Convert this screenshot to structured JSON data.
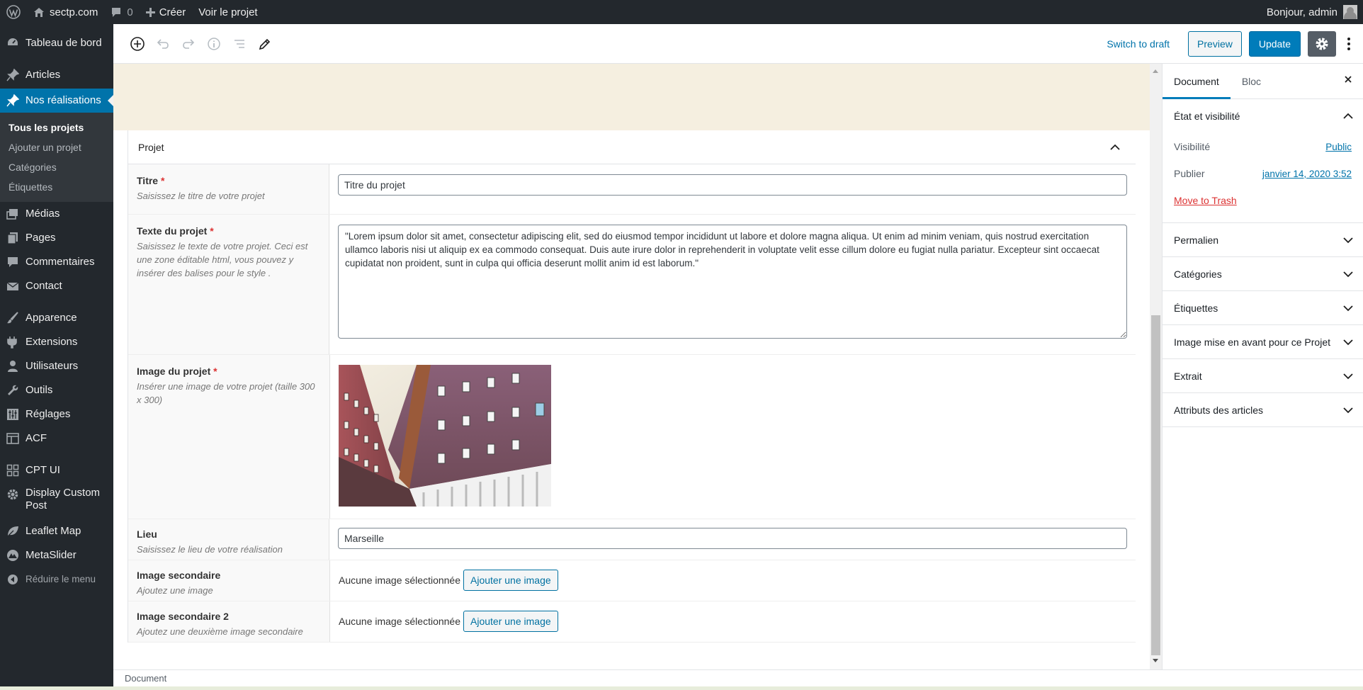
{
  "adminbar": {
    "site_name": "sectp.com",
    "comments_count": "0",
    "create_label": "Créer",
    "view_label": "Voir le projet",
    "greeting": "Bonjour, admin"
  },
  "menu": {
    "dashboard": "Tableau de bord",
    "articles": "Articles",
    "realisations": "Nos réalisations",
    "sub": [
      "Tous les projets",
      "Ajouter un projet",
      "Catégories",
      "Étiquettes"
    ],
    "media": "Médias",
    "pages": "Pages",
    "comments": "Commentaires",
    "contact": "Contact",
    "appearance": "Apparence",
    "extensions": "Extensions",
    "users": "Utilisateurs",
    "tools": "Outils",
    "settings": "Réglages",
    "acf": "ACF",
    "cptui": "CPT UI",
    "display_custom_post": "Display Custom Post",
    "leaflet": "Leaflet Map",
    "metaslider": "MetaSlider",
    "collapse": "Réduire le menu"
  },
  "toolbar": {
    "switch_draft": "Switch to draft",
    "preview": "Preview",
    "update": "Update"
  },
  "metabox": {
    "title": "Projet",
    "fields": {
      "titre": {
        "label": "Titre",
        "required": "*",
        "desc": "Saisissez le titre de votre projet",
        "value": "Titre du projet"
      },
      "texte": {
        "label": "Texte du projet",
        "required": "*",
        "desc": "Saisissez le texte de votre projet. Ceci est une zone éditable html, vous pouvez y insérer des balises pour le style .",
        "value": "\"Lorem ipsum dolor sit amet, consectetur adipiscing elit, sed do eiusmod tempor incididunt ut labore et dolore magna aliqua. Ut enim ad minim veniam, quis nostrud exercitation ullamco laboris nisi ut aliquip ex ea commodo consequat. Duis aute irure dolor in reprehenderit in voluptate velit esse cillum dolore eu fugiat nulla pariatur. Excepteur sint occaecat cupidatat non proident, sunt in culpa qui officia deserunt mollit anim id est laborum.\""
      },
      "image": {
        "label": "Image du projet",
        "required": "*",
        "desc": "Insérer une image de votre projet (taille 300 x 300)"
      },
      "lieu": {
        "label": "Lieu",
        "desc": "Saisissez le lieu de votre réalisation",
        "value": "Marseille"
      },
      "image2": {
        "label": "Image secondaire",
        "desc": "Ajoutez une image",
        "status": "Aucune image sélectionnée",
        "button": "Ajouter une image"
      },
      "image3": {
        "label": "Image secondaire 2",
        "desc": "Ajoutez une deuxième image secondaire",
        "status": "Aucune image sélectionnée",
        "button": "Ajouter une image"
      }
    }
  },
  "sidebar": {
    "tabs": [
      "Document",
      "Bloc"
    ],
    "status_panel": {
      "title": "État et visibilité",
      "visibility_label": "Visibilité",
      "visibility_value": "Public",
      "publish_label": "Publier",
      "publish_value": "janvier 14, 2020 3:52",
      "trash": "Move to Trash"
    },
    "panels": [
      "Permalien",
      "Catégories",
      "Étiquettes",
      "Image mise en avant pour ce Projet",
      "Extrait",
      "Attributs des articles"
    ]
  },
  "footer": {
    "breadcrumb": "Document"
  }
}
